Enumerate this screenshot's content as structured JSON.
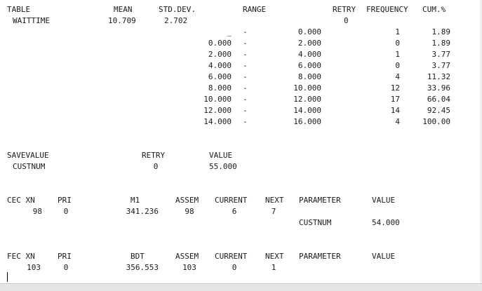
{
  "table": {
    "headers": [
      "TABLE",
      "MEAN",
      "STD.DEV.",
      "RANGE",
      "RETRY",
      "FREQUENCY",
      "CUM.%"
    ],
    "name": "WAITTIME",
    "mean": "10.709",
    "std_dev": "2.702",
    "retry": "0",
    "rows": [
      {
        "from": "_",
        "to": "0.000",
        "freq": "1",
        "cum": "1.89"
      },
      {
        "from": "0.000",
        "to": "2.000",
        "freq": "0",
        "cum": "1.89"
      },
      {
        "from": "2.000",
        "to": "4.000",
        "freq": "1",
        "cum": "3.77"
      },
      {
        "from": "4.000",
        "to": "6.000",
        "freq": "0",
        "cum": "3.77"
      },
      {
        "from": "6.000",
        "to": "8.000",
        "freq": "4",
        "cum": "11.32"
      },
      {
        "from": "8.000",
        "to": "10.000",
        "freq": "12",
        "cum": "33.96"
      },
      {
        "from": "10.000",
        "to": "12.000",
        "freq": "17",
        "cum": "66.04"
      },
      {
        "from": "12.000",
        "to": "14.000",
        "freq": "14",
        "cum": "92.45"
      },
      {
        "from": "14.000",
        "to": "16.000",
        "freq": "4",
        "cum": "100.00"
      }
    ],
    "dash": "-"
  },
  "savevalue": {
    "headers": [
      "SAVEVALUE",
      "RETRY",
      "VALUE"
    ],
    "name": "CUSTNUM",
    "retry": "0",
    "value": "55.000"
  },
  "cec": {
    "headers": [
      "CEC XN",
      "PRI",
      "M1",
      "ASSEM",
      "CURRENT",
      "NEXT",
      "PARAMETER",
      "VALUE"
    ],
    "row": {
      "xn": "98",
      "pri": "0",
      "m1": "341.236",
      "assem": "98",
      "current": "6",
      "next": "7"
    },
    "param": {
      "name": "CUSTNUM",
      "value": "54.000"
    }
  },
  "fec": {
    "headers": [
      "FEC XN",
      "PRI",
      "BDT",
      "ASSEM",
      "CURRENT",
      "NEXT",
      "PARAMETER",
      "VALUE"
    ],
    "row": {
      "xn": "103",
      "pri": "0",
      "bdt": "356.553",
      "assem": "103",
      "current": "0",
      "next": "1"
    }
  }
}
